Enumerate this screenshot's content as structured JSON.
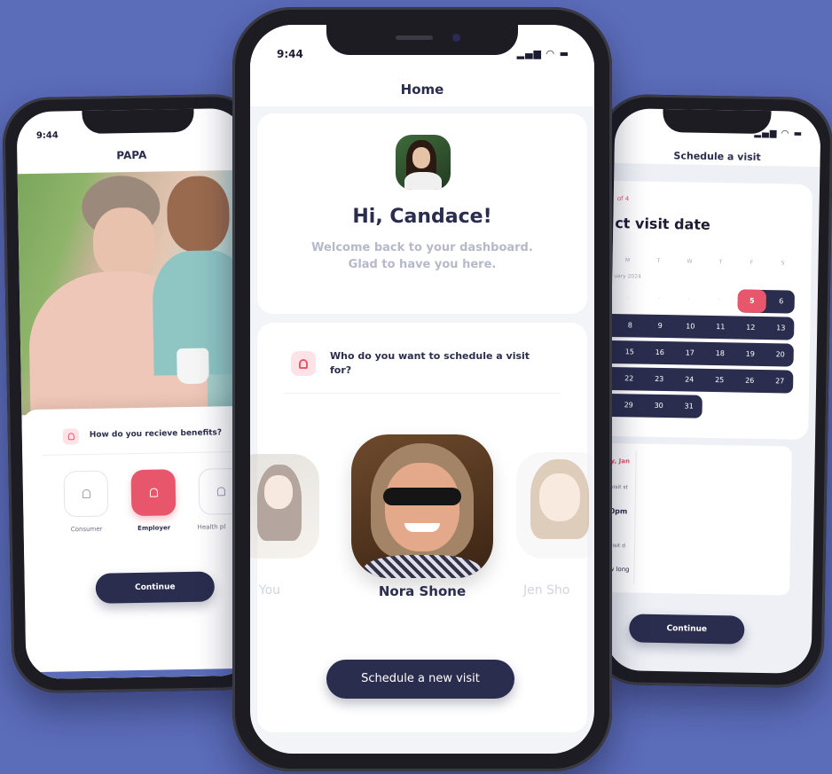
{
  "left": {
    "time": "9:44",
    "title": "PAPA",
    "question": "How do you recieve benefits?",
    "options": [
      {
        "label": "Consumer",
        "selected": false
      },
      {
        "label": "Employer",
        "selected": true
      },
      {
        "label": "Health pl",
        "selected": false
      }
    ],
    "cta": "Continue"
  },
  "center": {
    "time": "9:44",
    "title": "Home",
    "greeting": "Hi, Candace!",
    "welcome": "Welcome back to your dashboard. Glad to have you here.",
    "question": "Who do you want to schedule a visit for?",
    "people": [
      {
        "name": "You",
        "active": false
      },
      {
        "name": "Nora Shone",
        "active": true
      },
      {
        "name": "Jen Sho",
        "active": false
      }
    ],
    "cta": "Schedule a new visit"
  },
  "right": {
    "title": "Schedule a visit",
    "step": "of 4",
    "heading": "ct visit date",
    "weekdays": [
      "M",
      "T",
      "W",
      "T",
      "F",
      "S"
    ],
    "month": "uary 2024",
    "weeks": [
      [
        "",
        "",
        "",
        "",
        "5",
        "6"
      ],
      [
        "",
        "8",
        "9",
        "10",
        "11",
        "12",
        "13"
      ],
      [
        "",
        "15",
        "16",
        "17",
        "18",
        "19",
        "20"
      ],
      [
        "",
        "22",
        "23",
        "24",
        "25",
        "26",
        "27"
      ],
      [
        "",
        "29",
        "30",
        "31"
      ]
    ],
    "selected_day": "5",
    "detail_lines": [
      "y, Jan",
      "visit st",
      "0pm",
      "visit d",
      "w long"
    ],
    "cta": "Continue"
  },
  "colors": {
    "background": "#5b6cb9",
    "navy": "#2b2d4e",
    "accent": "#e8566b"
  }
}
